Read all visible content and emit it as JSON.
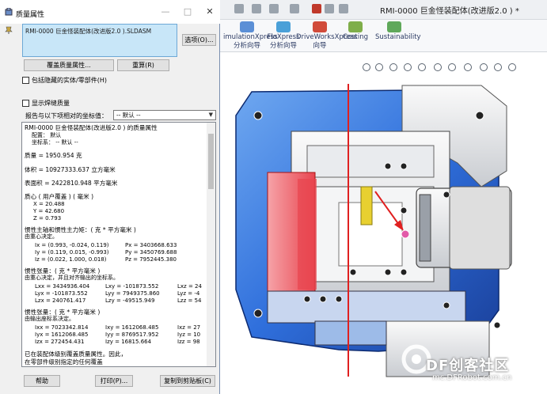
{
  "app": {
    "title": "RMI-0000 巨金怪装配体(改进版2.0 )  *",
    "commands": [
      {
        "label_line1": "imulationXpress",
        "label_line2": "分析向导"
      },
      {
        "label_line1": "FloXpress",
        "label_line2": "分析向导"
      },
      {
        "label_line1": "DriveWorksXpress",
        "label_line2": "向导"
      },
      {
        "label_line1": "Costing",
        "label_line2": ""
      },
      {
        "label_line1": "Sustainability",
        "label_line2": ""
      }
    ]
  },
  "dialog": {
    "title": "质量属性",
    "selection": "RMI-0000 巨金怪装配体(改进版2.0 ).SLDASM",
    "options_button": "选项(O)...",
    "override_button": "覆盖质量属性...",
    "recalc_button": "重算(R)",
    "include_hidden_label": "包括隐藏的实体/零部件(H)",
    "show_weld_label": "显示焊缝质量",
    "report_coord_label": "报告与以下项相对的坐标值：",
    "coord_value": "-- 默认 --",
    "results": [
      "RMI-0000 巨金怪装配体(改进版2.0 ) 的质量属性",
      "配置：  默认",
      "坐标系：  -- 默认 --",
      "质量 = 1950.954 克",
      "体积 = 10927333.637 立方毫米",
      "表面积 = 2422810.948  平方毫米",
      "质心 ( 用户覆盖 ) ( 毫米 )",
      "X = 20.488",
      "Y = 42.680",
      "Z = 0.793",
      "惯性主轴和惯性主力矩：( 克 *  平方毫米 )",
      "由重心决定。",
      "Ix = (0.993, -0.024,  0.119)",
      "Px = 3403668.633",
      "Iy = (0.119,  0.015, -0.993)",
      "Py = 3450769.688",
      "Iz = (0.022,  1.000,  0.018)",
      "Pz = 7952445.380",
      "惯性张量：( 克 *  平方毫米 )",
      "由重心决定，并且对齐输出的坐标系。",
      "Lxx = 3434936.404",
      "Lxy = -101873.552",
      "Lxz = 24",
      "Lyx = -101873.552",
      "Lyy = 7949375.860",
      "Lyz = -4",
      "Lzx = 240761.417",
      "Lzy = -49515.949",
      "Lzz = 54",
      "惯性张量：( 克 *  平方毫米 )",
      "由输出座标系决定。",
      "Ixx = 7023342.814",
      "Ixy = 1612068.485",
      "Ixz = 27",
      "Iyx = 1612068.485",
      "Iyy = 8769517.952",
      "Iyz = 10",
      "Izx = 272454.431",
      "Izy = 16815.664",
      "Izz = 98",
      "已在装配体级别覆盖质量属性。因此，",
      "在零部件级别指定的任何覆盖"
    ],
    "help_button": "帮助",
    "print_button": "打印(P)...",
    "copy_button": "复制到剪贴板(C)"
  },
  "watermark": {
    "brand": "DF创客社区",
    "url": "mc.DFRobot.com.cn"
  },
  "colors": {
    "part_blue": "#2f6fdc",
    "part_red": "#e8454f",
    "part_yellow": "#e8d030",
    "section_line": "#e02020"
  }
}
